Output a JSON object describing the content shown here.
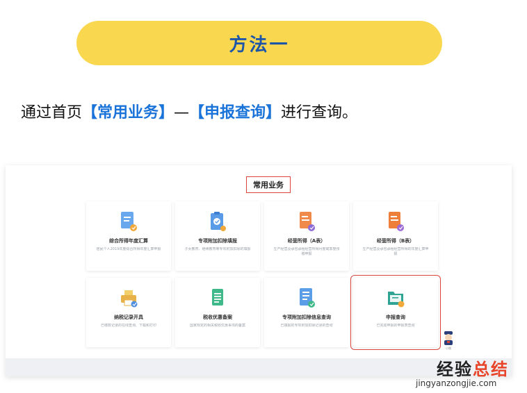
{
  "header": {
    "method_label": "方法一"
  },
  "intro": {
    "prefix": "通过首页",
    "home_link": "【常用业务】",
    "separator": "—",
    "query_link": "【申报查询】",
    "suffix": "进行查询。"
  },
  "panel": {
    "section_title": "常用业务",
    "cards": [
      {
        "title": "综合所得年度汇算",
        "desc": "居民个人2019年度综合所得年度汇算申报",
        "icon": "document-blue-icon"
      },
      {
        "title": "专项附加扣除填报",
        "desc": "子女教育、继续教育等专项附加扣除的填报",
        "icon": "clipboard-blue-icon"
      },
      {
        "title": "经营所得（A表）",
        "desc": "生产经营及承包承租经营所得月度或季度预缴申报",
        "icon": "document-orange-icon"
      },
      {
        "title": "经营所得（B表）",
        "desc": "生产经营及承包承租经营所得的年度汇算申报",
        "icon": "document-orange-b-icon"
      },
      {
        "title": "纳税记录开具",
        "desc": "已缴款记录的在线查询、下载和打印",
        "icon": "printer-icon"
      },
      {
        "title": "税收优惠备案",
        "desc": "国家规定的相关税收优惠事项的备案",
        "icon": "ledger-green-icon"
      },
      {
        "title": "专项附加扣除信息查询",
        "desc": "已填报的专项附加扣除记录的查询",
        "icon": "checklist-blue-icon"
      },
      {
        "title": "申报查询",
        "desc": "已完成申报的申报表查询",
        "icon": "folder-teal-icon",
        "selected": true
      }
    ]
  },
  "assistant": {
    "label": "小税",
    "icon": "tax-assistant-icon"
  },
  "watermark": {
    "text_main": "经验",
    "text_accent": "总结",
    "url": "jingyanzongjie.com"
  },
  "colors": {
    "pill": "#f9d74f",
    "pill_text": "#1d56a8",
    "link_blue": "#1a73d9",
    "highlight_red": "#d9453a"
  }
}
